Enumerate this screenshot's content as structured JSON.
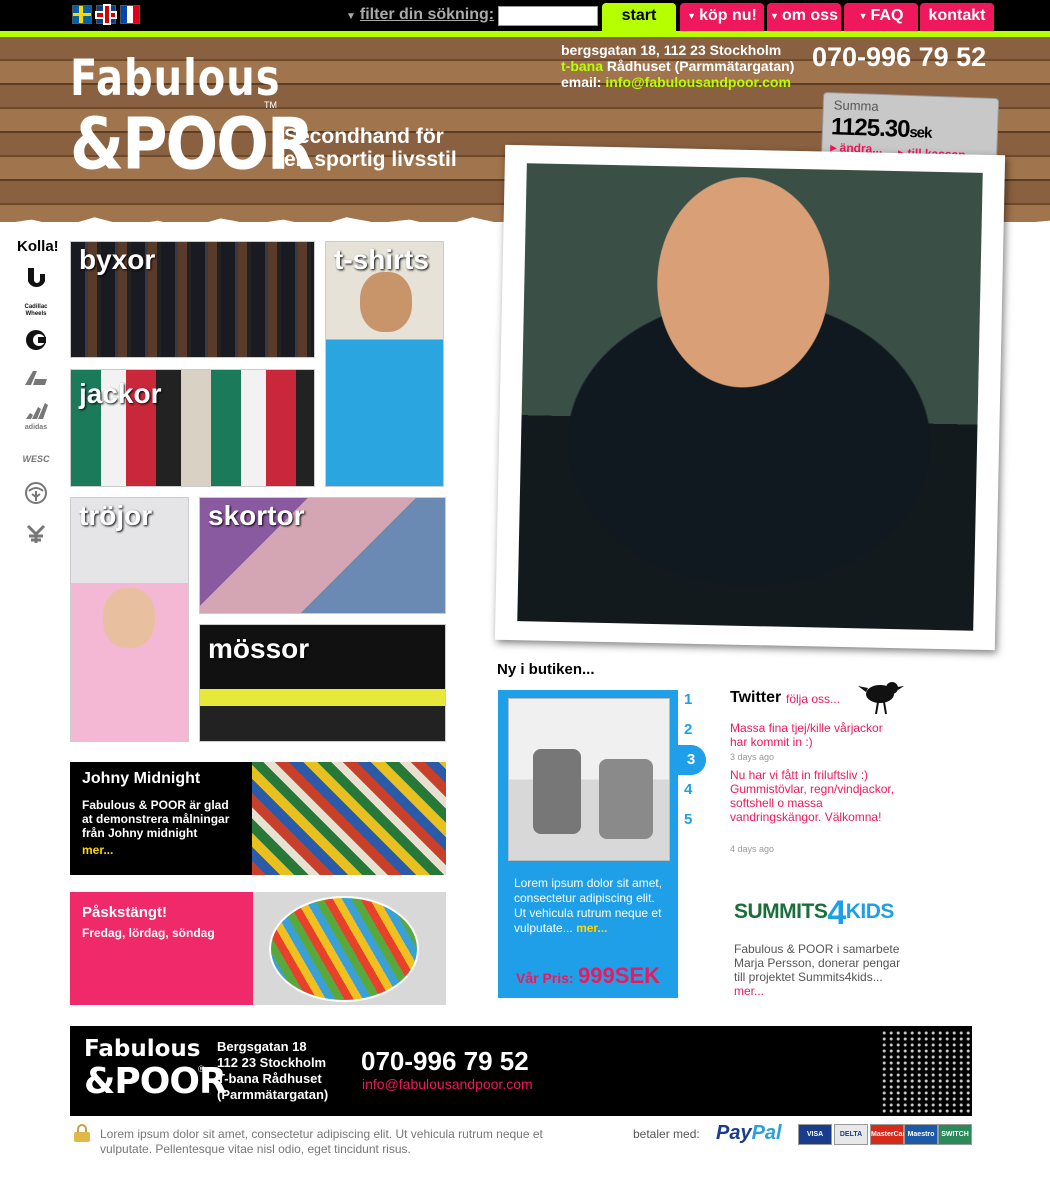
{
  "topbar": {
    "languages": [
      "svenska",
      "english",
      "français"
    ],
    "filter_label": "filter din sökning:",
    "search_value": "",
    "nav": {
      "start": "start",
      "kop": "köp nu!",
      "om": "om oss",
      "faq": "FAQ",
      "kontakt": "kontakt"
    }
  },
  "header": {
    "logo_line1": "Fabulous",
    "logo_line2": "&POOR",
    "tm": "TM",
    "tagline_1": "Secondhand för",
    "tagline_2": "en sportig livsstil",
    "address": "bergsgatan 18, 112 23 Stockholm",
    "tbana_label": "t-bana",
    "tbana": "Rådhuset (Parmmätargatan)",
    "email_label": "email:",
    "email": "info@fabulousandpoor.com",
    "phone": "070-996 79 52"
  },
  "cart": {
    "label": "Summa",
    "amount": "1125.30",
    "currency": "sek",
    "change": "▸ ändra...",
    "checkout": "▸ till kassan..."
  },
  "kolla": {
    "title": "Kolla!",
    "brands": [
      "burton-icon",
      "cadillac-wheels-icon",
      "carhartt-icon",
      "analog-icon",
      "adidas-icon",
      "wesc-icon",
      "arbor-icon",
      "zoo-york-icon"
    ],
    "cadillac": "Cadillac Wheels",
    "adidas": "adidas",
    "wesc": "WESC"
  },
  "categories": {
    "byxor": "byxor",
    "tshirts": "t-shirts",
    "jackor": "jackor",
    "trojor": "tröjor",
    "skortor": "skortor",
    "mossor": "mössor"
  },
  "ny": {
    "title": "Ny i butiken...",
    "text": "Lorem ipsum dolor sit amet, consectetur adipiscing elit. Ut vehicula rutrum neque et vulputate...",
    "mer": "mer...",
    "price_label": "Vår Pris:",
    "price": "999SEK",
    "pages": [
      "1",
      "2",
      "3",
      "4",
      "5"
    ]
  },
  "twitter": {
    "title": "Twitter",
    "follow": "följa oss...",
    "tweets": [
      {
        "text": "Massa fina tjej/kille vårjackor har kommit in :)",
        "date": "3 days ago"
      },
      {
        "text": "Nu har vi fått in friluftsliv :) Gummistövlar, regn/vindjackor, softshell o massa vandringskängor. Välkomna!",
        "date": "4 days ago"
      }
    ]
  },
  "summits": {
    "logo_a": "SUMMITS",
    "logo_b": "4",
    "logo_c": "KIDS",
    "text": "Fabulous & POOR i samarbete Marja Persson, donerar pengar till projektet Summits4kids...",
    "mer": "mer..."
  },
  "johny": {
    "title": "Johny Midnight",
    "text": "Fabulous & POOR är glad at demonstrera målningar från Johny midnight",
    "mer": "mer..."
  },
  "pask": {
    "title": "Påskstängt!",
    "text": "Fredag, lördag, söndag"
  },
  "footer": {
    "logo_line1": "Fabulous",
    "logo_line2": "&POOR",
    "reg": "®",
    "addr1": "Bergsgatan 18",
    "addr2": "112 23 Stockholm",
    "addr3": "T-bana Rådhuset",
    "addr4": "(Parmmätargatan)",
    "phone": "070-996 79 52",
    "email": "info@fabulousandpoor.com"
  },
  "bottom": {
    "lorem": "Lorem ipsum dolor sit amet, consectetur adipiscing elit. Ut vehicula rutrum neque et vulputate. Pellentesque vitae nisl odio, eget tincidunt risus.",
    "betaler": "betaler med:",
    "paypal_a": "Pay",
    "paypal_b": "Pal",
    "cards": {
      "visa": "VISA",
      "delta": "DELTA",
      "mastercard": "MasterCard",
      "maestro": "Maestro",
      "switch": "SWITCH"
    }
  },
  "colors": {
    "accent_green": "#b6ff00",
    "accent_pink": "#f0185c",
    "accent_blue": "#1e9fe8"
  }
}
